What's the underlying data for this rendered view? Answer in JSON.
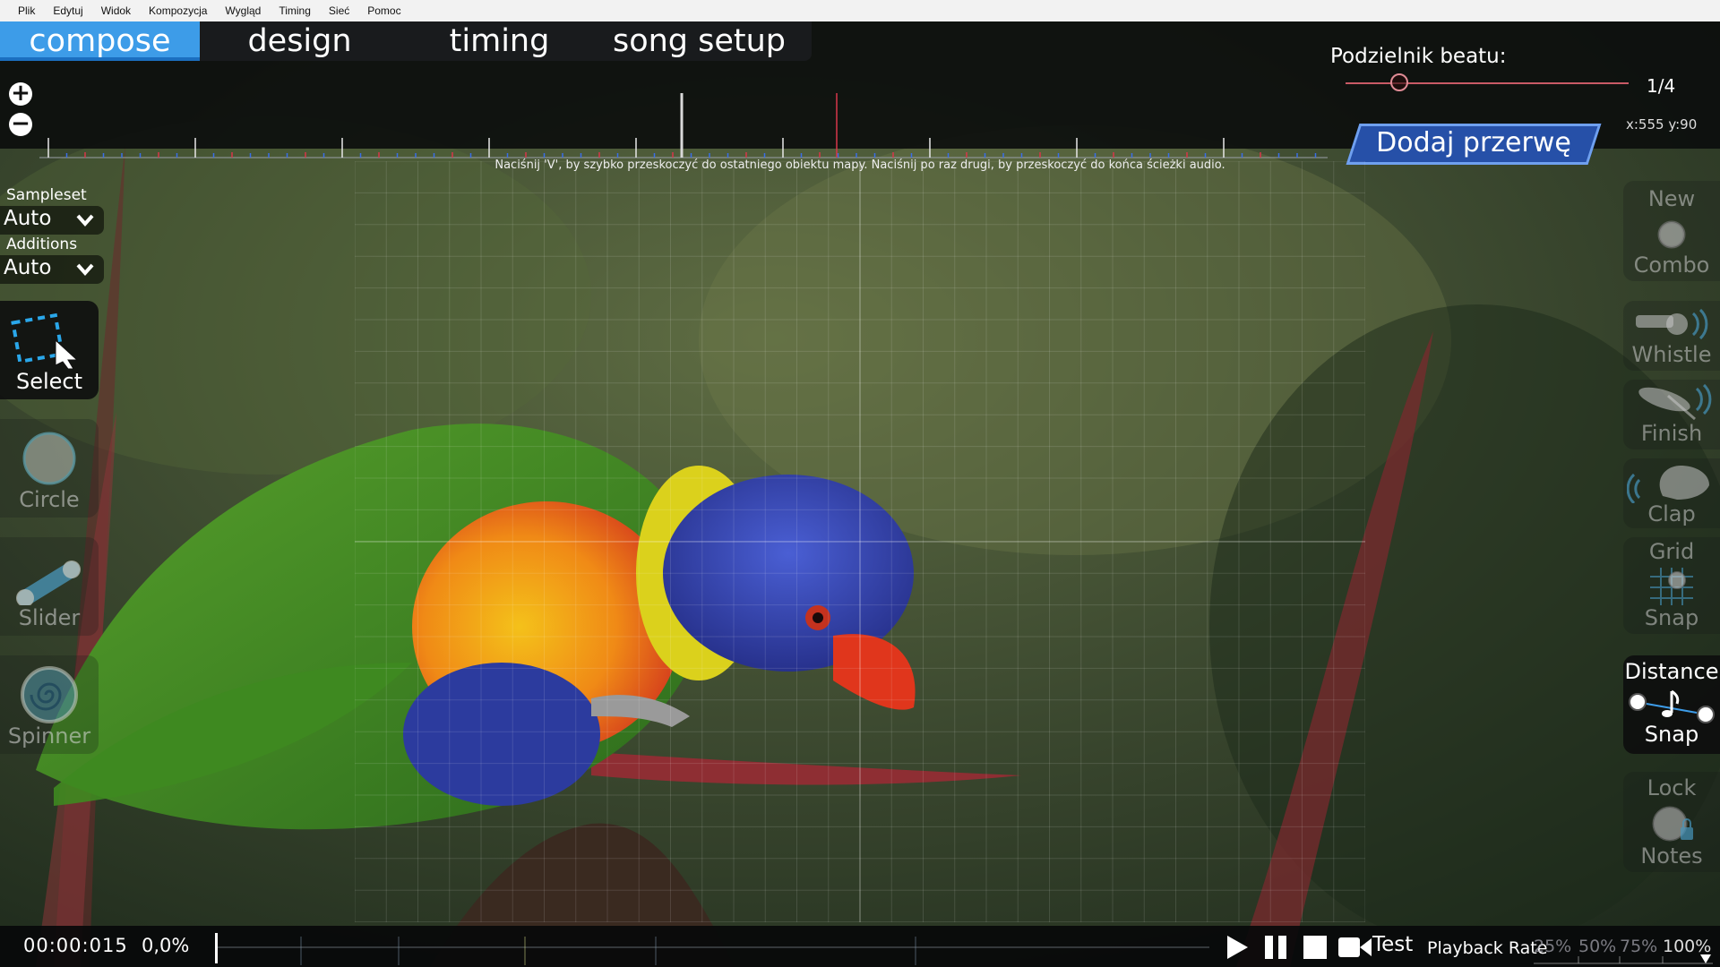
{
  "menu": [
    "Plik",
    "Edytuj",
    "Widok",
    "Kompozycja",
    "Wygląd",
    "Timing",
    "Sieć",
    "Pomoc"
  ],
  "mode_tabs": [
    {
      "label": "compose",
      "active": true
    },
    {
      "label": "design",
      "active": false
    },
    {
      "label": "timing",
      "active": false
    },
    {
      "label": "song setup",
      "active": false
    }
  ],
  "beat_divisor": {
    "label": "Podzielnik beatu:",
    "value": "1/4",
    "fraction": 0.1
  },
  "break_button": "Dodaj przerwę",
  "cursor_coords": "x:555 y:90",
  "hint": "Naciśnij 'V', by szybko przeskoczyć do ostatniego obiektu mapy. Naciśnij po raz drugi, by przeskoczyć do końca ścieżki audio.",
  "left_panel": {
    "sampleset_label": "Sampleset",
    "sampleset_value": "Auto",
    "additions_label": "Additions",
    "additions_value": "Auto",
    "tools": [
      {
        "label": "Select",
        "icon": "select-icon",
        "active": true
      },
      {
        "label": "Circle",
        "icon": "circle-icon",
        "active": false
      },
      {
        "label": "Slider",
        "icon": "slider-icon",
        "active": false
      },
      {
        "label": "Spinner",
        "icon": "spinner-icon",
        "active": false
      }
    ]
  },
  "right_panel": {
    "new_combo": {
      "line1": "New",
      "line2": "Combo",
      "active": false
    },
    "whistle": {
      "label": "Whistle",
      "active": false
    },
    "finish": {
      "label": "Finish",
      "active": false
    },
    "clap": {
      "label": "Clap",
      "active": false
    },
    "grid_snap": {
      "line1": "Grid",
      "line2": "Snap",
      "active": false
    },
    "distance_snap": {
      "line1": "Distance",
      "line2": "Snap",
      "active": true
    },
    "lock_notes": {
      "line1": "Lock",
      "line2": "Notes",
      "active": false
    }
  },
  "bottom": {
    "time": "00:00:015",
    "percent": "0,0%",
    "test_label": "Test",
    "playback_rate_label": "Playback Rate",
    "rates": [
      {
        "label": "25%",
        "active": false
      },
      {
        "label": "50%",
        "active": false
      },
      {
        "label": "75%",
        "active": false
      },
      {
        "label": "100%",
        "active": true
      }
    ]
  },
  "colors": {
    "accent": "#3d9ce8",
    "break_button": "#2650a8",
    "tick_red": "#d8364a",
    "tick_blue": "#3a6ee8"
  }
}
